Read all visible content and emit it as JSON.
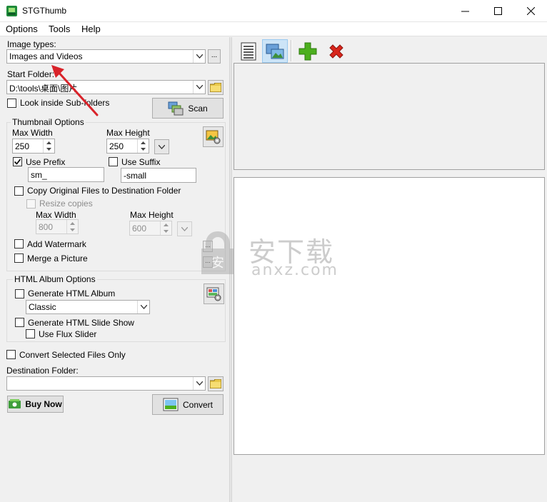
{
  "window": {
    "title": "STGThumb"
  },
  "menu": [
    "Options",
    "Tools",
    "Help"
  ],
  "left": {
    "image_types_label": "Image types:",
    "image_types_value": "Images and Videos",
    "ellipsis": "...",
    "start_folder_label": "Start Folder:",
    "start_folder_value": "D:\\tools\\桌面\\图片",
    "look_inside_label": "Look inside Sub-folders",
    "scan_label": "Scan",
    "thumbnail_group_title": "Thumbnail Options",
    "max_width_label": "Max Width",
    "max_height_label": "Max Height",
    "max_width_value": "250",
    "max_height_value": "250",
    "use_prefix_label": "Use Prefix",
    "use_prefix_checked": true,
    "prefix_value": "sm_",
    "use_suffix_label": "Use Suffix",
    "suffix_value": "-small",
    "copy_original_label": "Copy Original Files to Destination Folder",
    "resize_copies_label": "Resize copies",
    "copy_max_width_label": "Max Width",
    "copy_max_height_label": "Max Height",
    "copy_max_width_value": "800",
    "copy_max_height_value": "600",
    "add_watermark_label": "Add Watermark",
    "merge_picture_label": "Merge a Picture",
    "html_group_title": "HTML Album Options",
    "generate_album_label": "Generate HTML Album",
    "album_style_value": "Classic",
    "generate_slideshow_label": "Generate HTML Slide Show",
    "use_flux_label": "Use Flux Slider",
    "convert_selected_label": "Convert Selected Files Only",
    "destination_label": "Destination Folder:",
    "destination_value": "",
    "buy_now_label": "Buy Now",
    "convert_label": "Convert"
  },
  "watermark": {
    "cn_text": "安下载",
    "latin_text": "anxz.com"
  },
  "icons": {
    "app": "app-icon",
    "list_view": "list-view-icon",
    "thumb_view": "thumbnail-view-icon",
    "add": "add-icon",
    "remove": "remove-icon"
  },
  "colors": {
    "accent_green": "#4caf1e",
    "remove_red": "#d9261c",
    "active_blue": "#cce4f7",
    "annotation_red": "#d9232a"
  }
}
